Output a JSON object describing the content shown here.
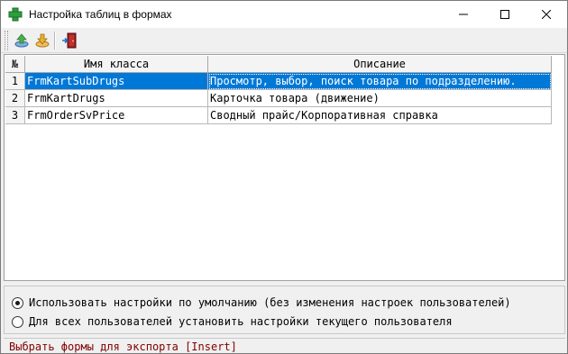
{
  "window": {
    "title": "Настройка таблиц в формах",
    "icon": "green-cross-icon"
  },
  "toolbar": {
    "buttons": [
      {
        "icon": "export-up-icon"
      },
      {
        "icon": "import-down-icon"
      },
      {
        "icon": "exit-door-icon"
      }
    ]
  },
  "grid": {
    "columns": [
      "№",
      "Имя класса",
      "Описание"
    ],
    "rows": [
      {
        "num": "1",
        "class_name": "FrmKartSubDrugs",
        "description": "Просмотр, выбор, поиск товара по подразделению.",
        "selected": true
      },
      {
        "num": "2",
        "class_name": "FrmKartDrugs",
        "description": "Карточка товара (движение)",
        "selected": false
      },
      {
        "num": "3",
        "class_name": "FrmOrderSvPrice",
        "description": "Сводный прайс/Корпоративная справка",
        "selected": false
      }
    ],
    "selection_color": "#0078d7"
  },
  "options": {
    "items": [
      {
        "label": "Использовать настройки по умолчанию (без изменения настроек пользователей)",
        "checked": true
      },
      {
        "label": "Для всех пользователей установить настройки текущего пользователя",
        "checked": false
      }
    ]
  },
  "status": {
    "text": "Выбрать формы для экспорта [Insert]",
    "color": "#800000"
  }
}
